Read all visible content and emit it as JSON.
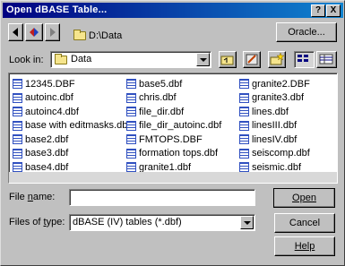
{
  "window": {
    "title": "Open dBASE Table...",
    "help_glyph": "?",
    "close_glyph": "X"
  },
  "toolbar": {
    "path": "D:\\Data",
    "oracle_label": "Oracle..."
  },
  "lookin": {
    "label": "Look in:",
    "value": "Data"
  },
  "files": {
    "columns": [
      [
        "12345.DBF",
        "autoinc.dbf",
        "autoinc4.dbf",
        "base with editmasks.dbf",
        "base2.dbf",
        "base3.dbf",
        "base4.dbf"
      ],
      [
        "base5.dbf",
        "chris.dbf",
        "file_dir.dbf",
        "file_dir_autoinc.dbf",
        "FMTOPS.DBF",
        "formation tops.dbf",
        "granite1.dbf"
      ],
      [
        "granite2.DBF",
        "granite3.dbf",
        "lines.dbf",
        "linesIII.dbf",
        "linesIV.dbf",
        "seiscomp.dbf",
        "seismic.dbf"
      ]
    ]
  },
  "filename": {
    "label": "File name:",
    "value": ""
  },
  "filetype": {
    "label": "Files of type:",
    "value": "dBASE (IV) tables (*.dbf)"
  },
  "buttons": {
    "open": "Open",
    "cancel": "Cancel",
    "help": "Help"
  }
}
